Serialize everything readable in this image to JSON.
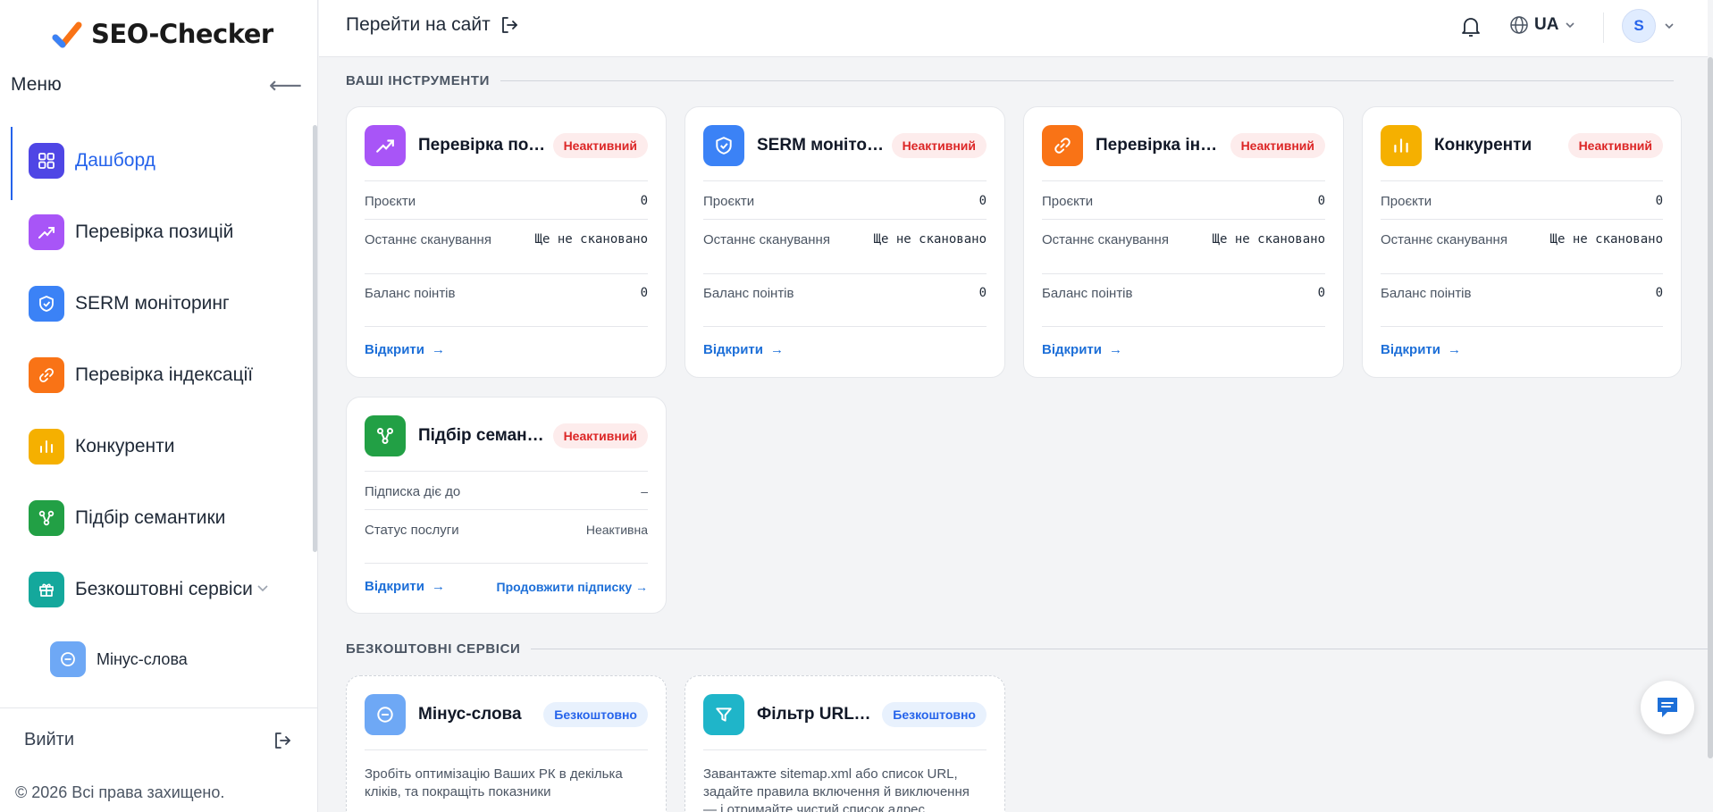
{
  "brand": {
    "name": "SEO-Checker"
  },
  "sidebar": {
    "menu_title": "Меню",
    "collapse_icon": "arrow-left-icon",
    "items": [
      {
        "label": "Дашборд",
        "icon": "dashboard-icon",
        "color": "#4f46e5",
        "active": true
      },
      {
        "label": "Перевірка позицій",
        "icon": "trend-icon",
        "color": "#a855f7"
      },
      {
        "label": "SERM моніторинг",
        "icon": "shield-icon",
        "color": "#3b82f6"
      },
      {
        "label": "Перевірка індексації",
        "icon": "link-icon",
        "color": "#f97316"
      },
      {
        "label": "Конкуренти",
        "icon": "bar-chart-icon",
        "color": "#f59e0b"
      },
      {
        "label": "Підбір семантики",
        "icon": "share-icon",
        "color": "#22a045"
      },
      {
        "label": "Безкоштовні сервіси",
        "icon": "gift-icon",
        "color": "#14a89c"
      }
    ],
    "sub_item": {
      "label": "Мінус-слова",
      "icon": "minus-circle-icon",
      "color": "#6ea8f5"
    },
    "logout_label": "Вийти",
    "copyright": "© 2026 Всі права захищено."
  },
  "header": {
    "goto_site": "Перейти на сайт",
    "lang": "UA",
    "user_initial": "S"
  },
  "tools_section": "ВАШІ ІНСТРУМЕНТИ",
  "free_section": "БЕЗКОШТОВНІ СЕРВІСИ",
  "tools": [
    {
      "title": "Перевірка позицій",
      "status": "Неактивний",
      "color": "#a855f7",
      "icon": "trend-icon",
      "rows": [
        {
          "k": "Проєкти",
          "v": "0"
        },
        {
          "k": "Останнє сканування",
          "v": "Ще не скановано"
        },
        {
          "k": "Баланс поінтів",
          "v": "0"
        }
      ]
    },
    {
      "title": "SERM моніторинг",
      "status": "Неактивний",
      "color": "#3b82f6",
      "icon": "shield-icon",
      "rows": [
        {
          "k": "Проєкти",
          "v": "0"
        },
        {
          "k": "Останнє сканування",
          "v": "Ще не скановано"
        },
        {
          "k": "Баланс поінтів",
          "v": "0"
        }
      ]
    },
    {
      "title": "Перевірка індексації",
      "status": "Неактивний",
      "color": "#f97316",
      "icon": "link-icon",
      "rows": [
        {
          "k": "Проєкти",
          "v": "0"
        },
        {
          "k": "Останнє сканування",
          "v": "Ще не скановано"
        },
        {
          "k": "Баланс поінтів",
          "v": "0"
        }
      ]
    },
    {
      "title": "Конкуренти",
      "status": "Неактивний",
      "color": "#f5b000",
      "icon": "bar-chart-icon",
      "rows": [
        {
          "k": "Проєкти",
          "v": "0"
        },
        {
          "k": "Останнє сканування",
          "v": "Ще не скановано"
        },
        {
          "k": "Баланс поінтів",
          "v": "0"
        }
      ]
    }
  ],
  "semantic_card": {
    "title": "Підбір семантики",
    "status": "Неактивний",
    "color": "#22a045",
    "icon": "share-icon",
    "rows": [
      {
        "k": "Підписка діє до",
        "v": "–"
      },
      {
        "k": "Статус послуги",
        "v": "Неактивна"
      }
    ],
    "extend": "Продовжити підписку →"
  },
  "open_label": "Відкрити",
  "free_services": [
    {
      "title": "Мінус-слова",
      "badge": "Безкоштовно",
      "color": "#6ea8f5",
      "icon": "minus-circle-icon",
      "desc": "Зробіть оптимізацію Ваших РК в декілька кліків, та покращіть показники"
    },
    {
      "title": "Фільтр URL по правилах",
      "badge": "Безкоштовно",
      "color": "#1fb5c9",
      "icon": "filter-icon",
      "desc": "Завантажте sitemap.xml або список URL, задайте правила включення й виключення — і отримайте чистий список адрес"
    }
  ]
}
